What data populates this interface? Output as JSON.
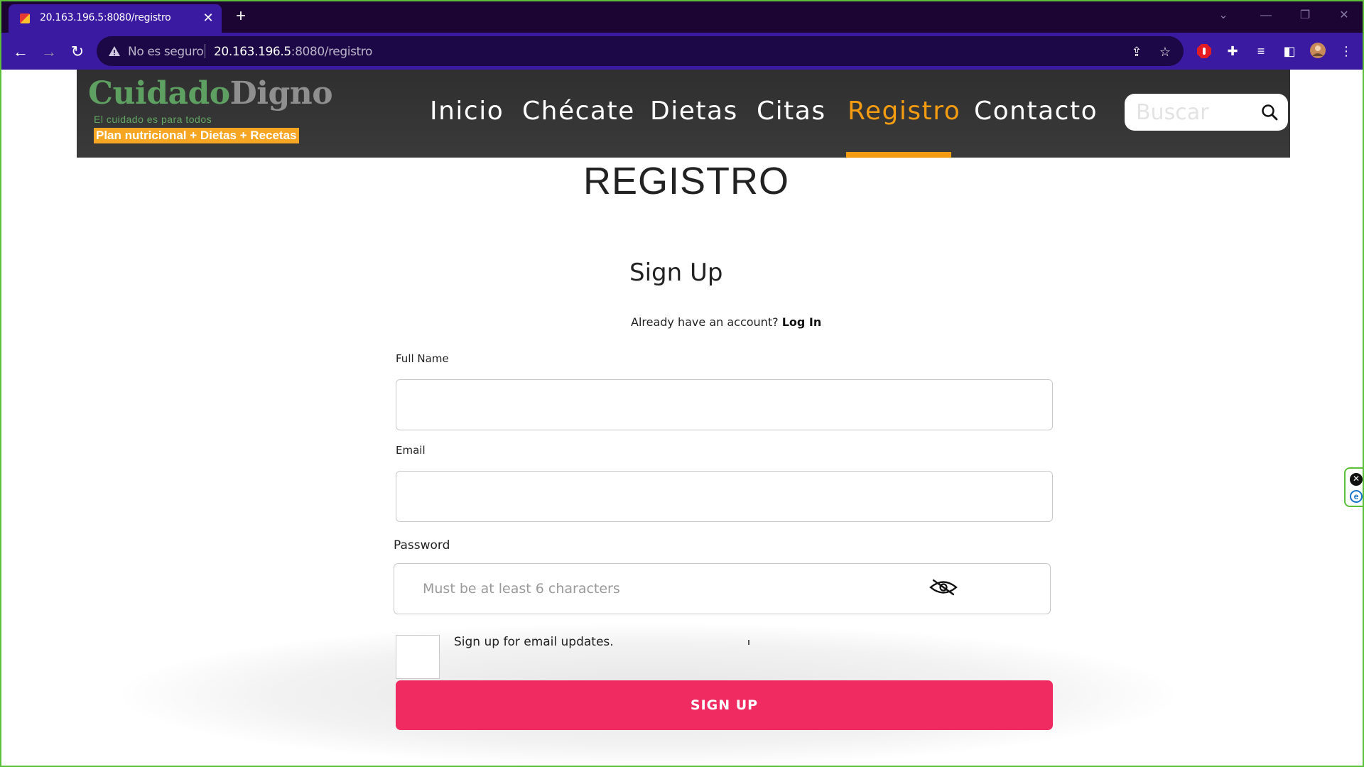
{
  "browser": {
    "tab_title": "20.163.196.5:8080/registro",
    "tab_close": "✕",
    "new_tab": "+",
    "security_label": "No es seguro",
    "url_host": "20.163.196.5",
    "url_path": ":8080/registro"
  },
  "site": {
    "logo_part1": "Cuidado",
    "logo_part2": "Digno",
    "tagline": "El cuidado es para todos",
    "promo": "Plan nutricional + Dietas + Recetas",
    "nav": [
      {
        "label": "Inicio"
      },
      {
        "label": "Chécate"
      },
      {
        "label": "Dietas"
      },
      {
        "label": "Citas"
      },
      {
        "label": "Registro",
        "active": true
      },
      {
        "label": "Contacto"
      }
    ],
    "search_placeholder": "Buscar",
    "accent_color": "#f39c12"
  },
  "main": {
    "heading": "REGISTRO",
    "form_title": "Sign Up",
    "already_text": "Already have an account?",
    "login_link": "Log In",
    "full_name_label": "Full Name",
    "email_label": "Email",
    "password_label": "Password",
    "password_placeholder": "Must be at least 6 characters",
    "updates_label": "Sign up for email updates.",
    "submit_label": "SIGN UP",
    "button_color": "#ef2b61"
  }
}
